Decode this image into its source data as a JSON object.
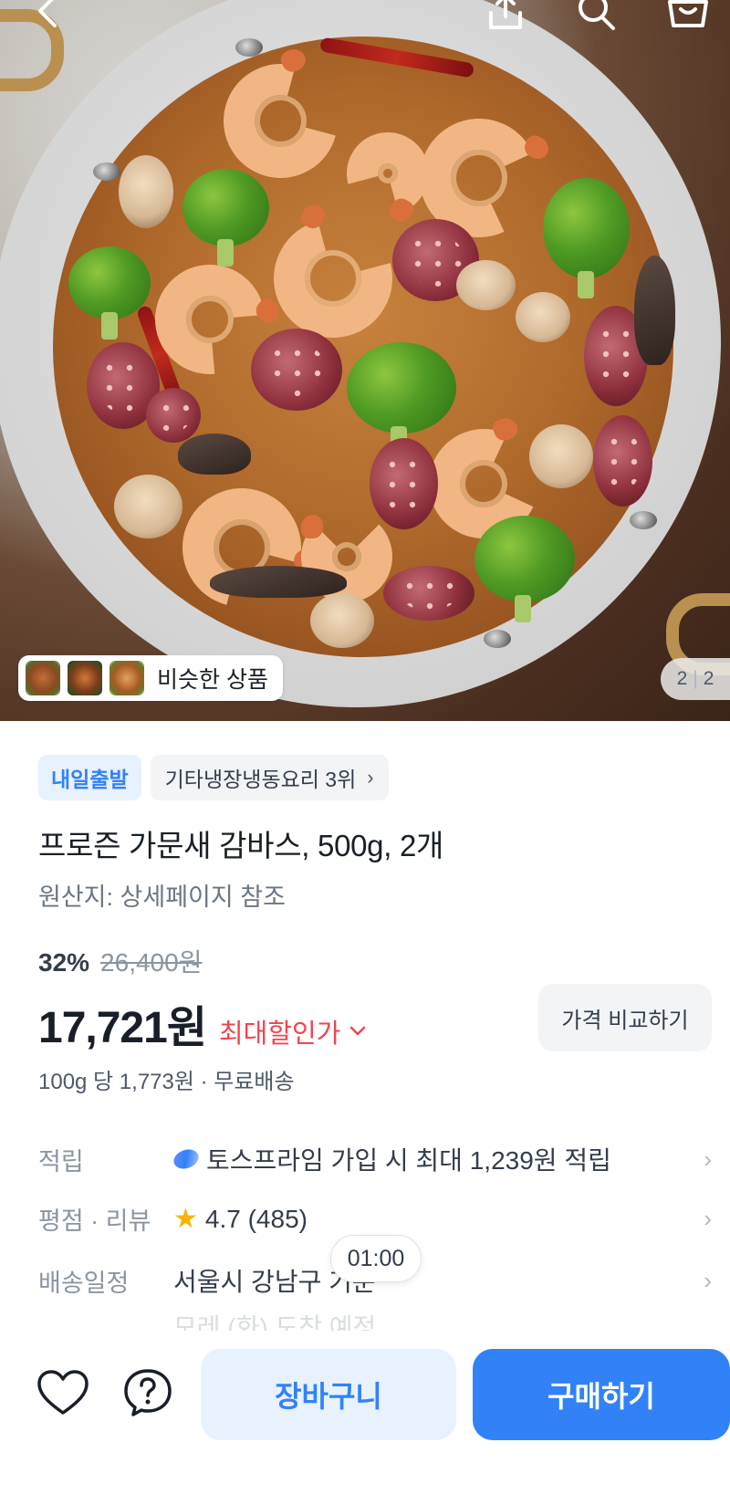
{
  "gallery": {
    "similar_label": "비슷한 상품",
    "pager_current": "2",
    "pager_total": "2"
  },
  "top_bar": {
    "icons": [
      "back-icon",
      "share-icon",
      "search-icon",
      "cart-icon"
    ]
  },
  "product": {
    "badge": "내일출발",
    "ranking": "기타냉장냉동요리 3위",
    "title": "프로즌 가문새 감바스, 500g, 2개",
    "origin": "원산지: 상세페이지 참조",
    "discount_pct": "32%",
    "original_price": "26,400원",
    "price": "17,721원",
    "max_discount_label": "최대할인가",
    "compare_button": "가격 비교하기",
    "unit_price": "100g 당 1,773원 · 무료배송"
  },
  "info": {
    "points_label": "적립",
    "points_value": "토스프라임 가입 시 최대 1,239원 적립",
    "rating_label": "평점 · 리뷰",
    "rating_value": "4.7 (485)",
    "delivery_label": "배송일정",
    "delivery_value": "서울시 강남구 기준",
    "delivery_sub": "모레 (화) 도착 예정",
    "time_bubble": "01:00"
  },
  "bottom": {
    "cart_button": "장바구니",
    "buy_button": "구매하기"
  },
  "colors": {
    "primary": "#3182f6",
    "primary_light": "#e8f1fe",
    "discount_red": "#f04452",
    "star": "#f7b500"
  }
}
